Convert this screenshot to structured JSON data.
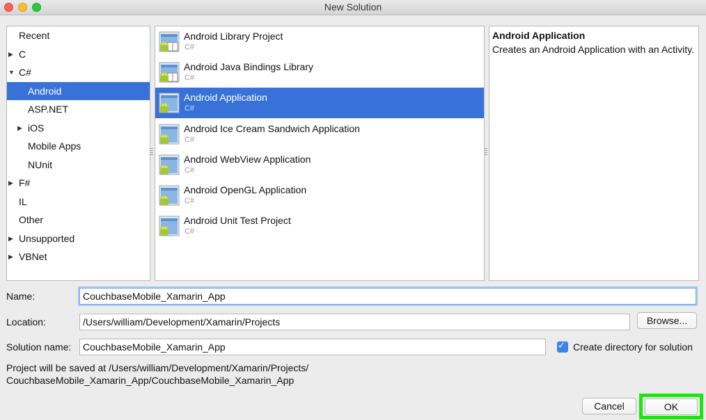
{
  "window": {
    "title": "New Solution"
  },
  "categories": [
    {
      "label": "Recent",
      "arrow": ""
    },
    {
      "label": "C",
      "arrow": "▶"
    },
    {
      "label": "C#",
      "arrow": "▼"
    },
    {
      "label": "Android",
      "arrow": "",
      "selected": true
    },
    {
      "label": "ASP.NET",
      "arrow": ""
    },
    {
      "label": "iOS",
      "arrow": "▶"
    },
    {
      "label": "Mobile Apps",
      "arrow": ""
    },
    {
      "label": "NUnit",
      "arrow": ""
    },
    {
      "label": "F#",
      "arrow": "▶"
    },
    {
      "label": "IL",
      "arrow": ""
    },
    {
      "label": "Other",
      "arrow": ""
    },
    {
      "label": "Unsupported",
      "arrow": "▶"
    },
    {
      "label": "VBNet",
      "arrow": "▶"
    }
  ],
  "templates": [
    {
      "name": "Android Library Project",
      "lang": "C#",
      "icon": "android-library-icon"
    },
    {
      "name": "Android Java Bindings Library",
      "lang": "C#",
      "icon": "android-library-icon"
    },
    {
      "name": "Android Application",
      "lang": "C#",
      "icon": "android-app-icon",
      "selected": true
    },
    {
      "name": "Android Ice Cream Sandwich Application",
      "lang": "C#",
      "icon": "android-app-icon"
    },
    {
      "name": "Android WebView Application",
      "lang": "C#",
      "icon": "android-app-icon"
    },
    {
      "name": "Android OpenGL Application",
      "lang": "C#",
      "icon": "android-app-icon"
    },
    {
      "name": "Android Unit Test Project",
      "lang": "C#",
      "icon": "android-app-icon"
    }
  ],
  "description": {
    "title": "Android Application",
    "text": "Creates an Android Application with an Activity."
  },
  "form": {
    "name_label": "Name:",
    "name_value": "CouchbaseMobile_Xamarin_App",
    "location_label": "Location:",
    "location_value": "/Users/william/Development/Xamarin/Projects",
    "browse_label": "Browse...",
    "solution_label": "Solution name:",
    "solution_value": "CouchbaseMobile_Xamarin_App",
    "create_dir_label": "Create directory for solution",
    "create_dir_checked": true,
    "save_path_line1": "Project will be saved at /Users/william/Development/Xamarin/Projects/",
    "save_path_line2": "CouchbaseMobile_Xamarin_App/CouchbaseMobile_Xamarin_App"
  },
  "buttons": {
    "cancel": "Cancel",
    "ok": "OK"
  },
  "colors": {
    "selection": "#3872d8",
    "ok_highlight": "#18e80d",
    "checkbox": "#3b84e9"
  }
}
